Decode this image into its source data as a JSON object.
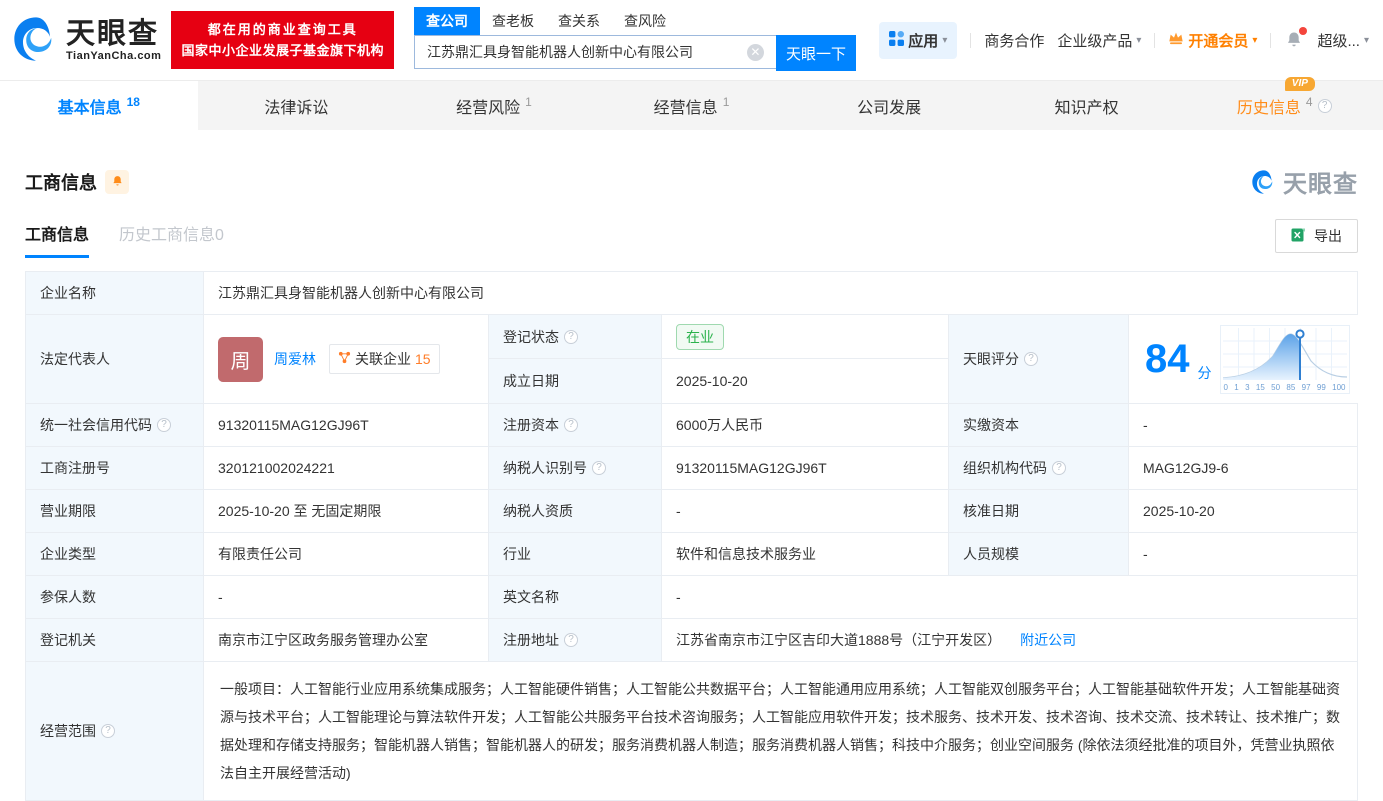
{
  "header": {
    "brand_name": "天眼查",
    "brand_domain": "TianYanCha.com",
    "promo_line1": "都在用的商业查询工具",
    "promo_line2": "国家中小企业发展子基金旗下机构",
    "search_tabs": [
      "查公司",
      "查老板",
      "查关系",
      "查风险"
    ],
    "search_value": "江苏鼎汇具身智能机器人创新中心有限公司",
    "search_button": "天眼一下",
    "nav": {
      "apps": "应用",
      "cooperation": "商务合作",
      "enterprise": "企业级产品",
      "vip": "开通会员",
      "super": "超级..."
    }
  },
  "tabs": [
    {
      "label": "基本信息",
      "count": "18"
    },
    {
      "label": "法律诉讼",
      "count": ""
    },
    {
      "label": "经营风险",
      "count": "1"
    },
    {
      "label": "经营信息",
      "count": "1"
    },
    {
      "label": "公司发展",
      "count": ""
    },
    {
      "label": "知识产权",
      "count": ""
    },
    {
      "label": "历史信息",
      "count": "4",
      "badge": "VIP"
    }
  ],
  "section": {
    "title": "工商信息",
    "subtab_active": "工商信息",
    "subtab_history": "历史工商信息0",
    "export_label": "导出",
    "watermark": "天眼查"
  },
  "info": {
    "company_name_label": "企业名称",
    "company_name": "江苏鼎汇具身智能机器人创新中心有限公司",
    "legal_rep_label": "法定代表人",
    "legal_rep_avatar": "周",
    "legal_rep_name": "周爱林",
    "related_label": "关联企业",
    "related_count": "15",
    "reg_status_label": "登记状态",
    "reg_status": "在业",
    "establish_label": "成立日期",
    "establish_date": "2025-10-20",
    "score_label": "天眼评分",
    "score_value": "84",
    "score_unit": "分",
    "score_ticks": [
      "0",
      "1",
      "3",
      "15",
      "50",
      "85",
      "97",
      "99",
      "100"
    ],
    "credit_code_label": "统一社会信用代码",
    "credit_code": "91320115MAG12GJ96T",
    "reg_capital_label": "注册资本",
    "reg_capital": "6000万人民币",
    "paid_capital_label": "实缴资本",
    "paid_capital": "-",
    "reg_no_label": "工商注册号",
    "reg_no": "320121002024221",
    "taxpayer_id_label": "纳税人识别号",
    "taxpayer_id": "91320115MAG12GJ96T",
    "org_code_label": "组织机构代码",
    "org_code": "MAG12GJ9-6",
    "term_label": "营业期限",
    "term": "2025-10-20 至 无固定期限",
    "taxpayer_quality_label": "纳税人资质",
    "taxpayer_quality": "-",
    "approval_label": "核准日期",
    "approval_date": "2025-10-20",
    "type_label": "企业类型",
    "type": "有限责任公司",
    "industry_label": "行业",
    "industry": "软件和信息技术服务业",
    "staff_label": "人员规模",
    "staff": "-",
    "insured_label": "参保人数",
    "insured": "-",
    "en_name_label": "英文名称",
    "en_name": "-",
    "authority_label": "登记机关",
    "authority": "南京市江宁区政务服务管理办公室",
    "address_label": "注册地址",
    "address": "江苏省南京市江宁区吉印大道1888号（江宁开发区）",
    "nearby": "附近公司",
    "scope_label": "经营范围",
    "scope": "一般项目：人工智能行业应用系统集成服务；人工智能硬件销售；人工智能公共数据平台；人工智能通用应用系统；人工智能双创服务平台；人工智能基础软件开发；人工智能基础资源与技术平台；人工智能理论与算法软件开发；人工智能公共服务平台技术咨询服务；人工智能应用软件开发；技术服务、技术开发、技术咨询、技术交流、技术转让、技术推广；数据处理和存储支持服务；智能机器人销售；智能机器人的研发；服务消费机器人制造；服务消费机器人销售；科技中介服务；创业空间服务 (除依法须经批准的项目外，凭营业执照依法自主开展经营活动)"
  }
}
